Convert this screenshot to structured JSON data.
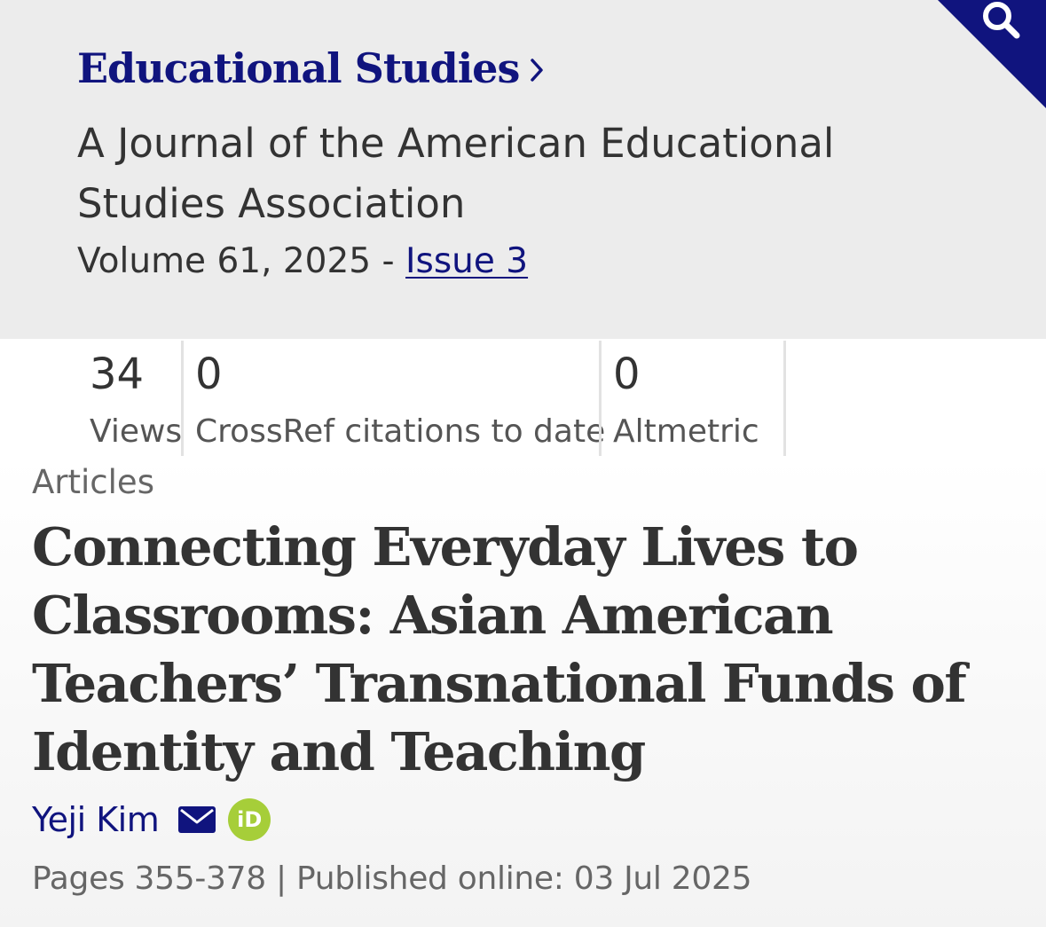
{
  "header": {
    "journal_title": "Educational Studies",
    "journal_subtitle": "A Journal of the American Educational Studies Association",
    "volume_text": "Volume 61, 2025 - ",
    "issue_label": "Issue 3",
    "search_icon": "search-icon"
  },
  "metrics": [
    {
      "value": "34",
      "label": "Views"
    },
    {
      "value": "0",
      "label": "CrossRef citations to date"
    },
    {
      "value": "0",
      "label": "Altmetric"
    }
  ],
  "article": {
    "type": "Articles",
    "title": "Connecting Everyday Lives to Classrooms: Asian American Teachers’ Transnational Funds of Identity and Teaching",
    "author": "Yeji Kim",
    "orcid_label": "iD",
    "publication_line": "Pages 355-378 | Published online: 03 Jul 2025"
  },
  "colors": {
    "brand_navy": "#10147e",
    "orcid_green": "#a6ce39",
    "header_bg": "#ececec"
  }
}
